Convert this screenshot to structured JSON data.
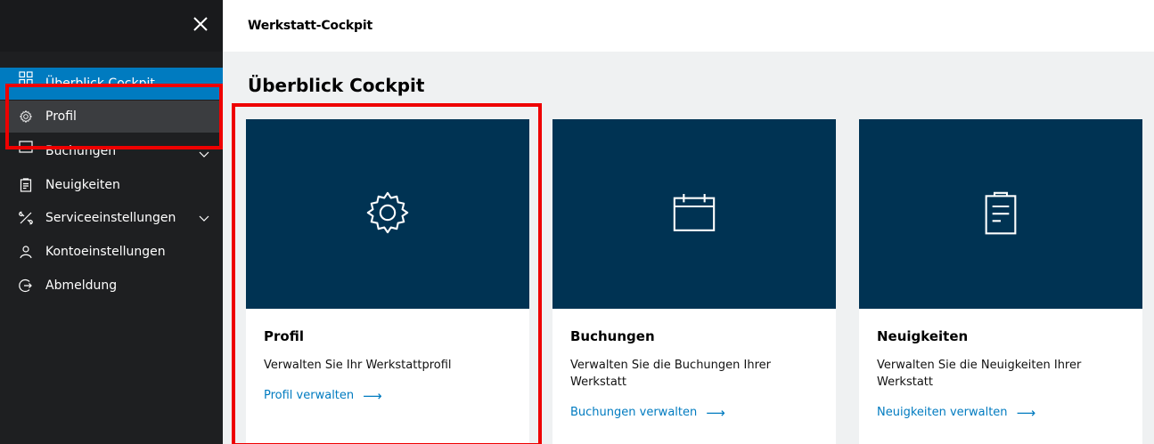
{
  "header": {
    "title": "Werkstatt-Cockpit"
  },
  "sidebar": {
    "items": [
      {
        "label": "Überblick Cockpit",
        "icon": "grid-icon"
      },
      {
        "label": "Profil",
        "icon": "gear-icon"
      },
      {
        "label": "Buchungen",
        "icon": "calendar-icon"
      },
      {
        "label": "Neuigkeiten",
        "icon": "clipboard-icon"
      },
      {
        "label": "Serviceeinstellungen",
        "icon": "tools-icon"
      },
      {
        "label": "Kontoeinstellungen",
        "icon": "user-icon"
      },
      {
        "label": "Abmeldung",
        "icon": "logout-icon"
      }
    ]
  },
  "main": {
    "page_title": "Überblick Cockpit",
    "cards": [
      {
        "title": "Profil",
        "description": "Verwalten Sie Ihr Werkstattprofil",
        "link": "Profil verwalten",
        "icon": "gear-icon"
      },
      {
        "title": "Buchungen",
        "description": "Verwalten Sie die Buchungen Ihrer Werkstatt",
        "link": "Buchungen verwalten",
        "icon": "calendar-icon"
      },
      {
        "title": "Neuigkeiten",
        "description": "Verwalten Sie die Neuigkeiten Ihrer Werkstatt",
        "link": "Neuigkeiten verwalten",
        "icon": "clipboard-icon"
      }
    ],
    "link_arrow": "⟶"
  },
  "colors": {
    "sidebar_bg": "#1e1f21",
    "accent": "#007bc0",
    "tile_bg": "#003353",
    "highlight": "#ee0000"
  }
}
